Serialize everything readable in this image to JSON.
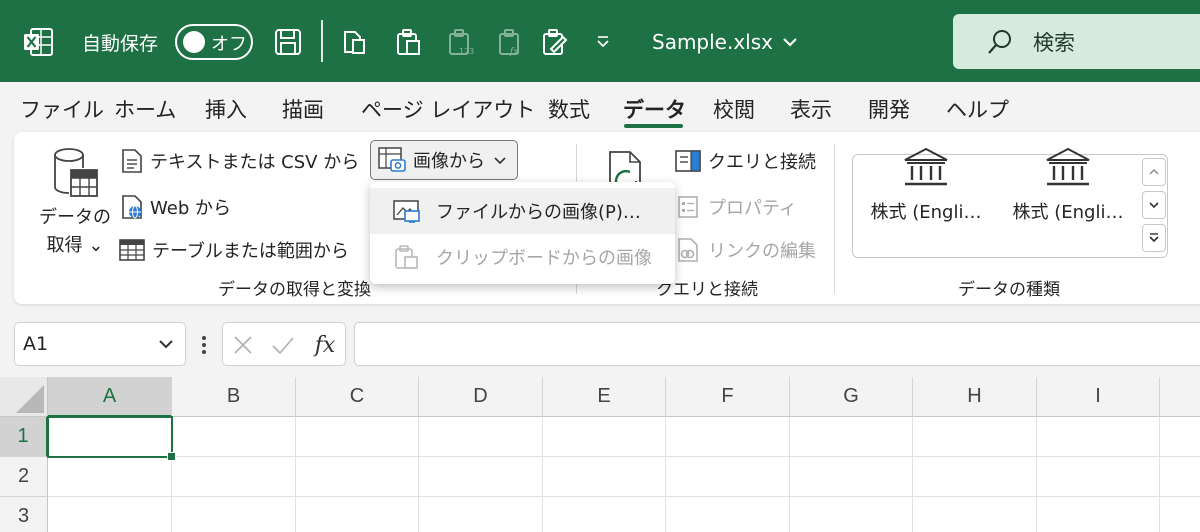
{
  "titlebar": {
    "autosave_label": "自動保存",
    "autosave_state": "オフ",
    "filename": "Sample.xlsx",
    "search_label": "検索"
  },
  "tabs": [
    {
      "label": "ファイル"
    },
    {
      "label": "ホーム"
    },
    {
      "label": "挿入"
    },
    {
      "label": "描画"
    },
    {
      "label": "ページ レイアウト"
    },
    {
      "label": "数式"
    },
    {
      "label": "データ",
      "active": true
    },
    {
      "label": "校閲"
    },
    {
      "label": "表示"
    },
    {
      "label": "開発"
    },
    {
      "label": "ヘルプ"
    }
  ],
  "ribbon": {
    "get_data": {
      "line1": "データの",
      "line2": "取得"
    },
    "from_text_csv": "テキストまたは CSV から",
    "from_web": "Web から",
    "from_table": "テーブルまたは範囲から",
    "from_image": "画像から",
    "group_get_transform": "データの取得と変換",
    "queries_connections": "クエリと接続",
    "properties": "プロパティ",
    "edit_links": "リンクの編集",
    "group_queries": "クエリと接続",
    "data_types": [
      {
        "label": "株式 (Engli…"
      },
      {
        "label": "株式 (Engli…"
      }
    ],
    "group_data_types": "データの種類"
  },
  "dropdown": {
    "items": [
      {
        "label": "ファイルからの画像(P)…",
        "enabled": true
      },
      {
        "label": "クリップボードからの画像",
        "enabled": false
      }
    ]
  },
  "formula_bar": {
    "name_box": "A1",
    "fx_label": "fx",
    "formula": ""
  },
  "grid": {
    "columns": [
      "A",
      "B",
      "C",
      "D",
      "E",
      "F",
      "G",
      "H",
      "I"
    ],
    "rows": [
      "1",
      "2",
      "3"
    ],
    "active_cell": "A1"
  },
  "colors": {
    "accent": "#1e7145",
    "search_bg": "#d6ebdd"
  }
}
